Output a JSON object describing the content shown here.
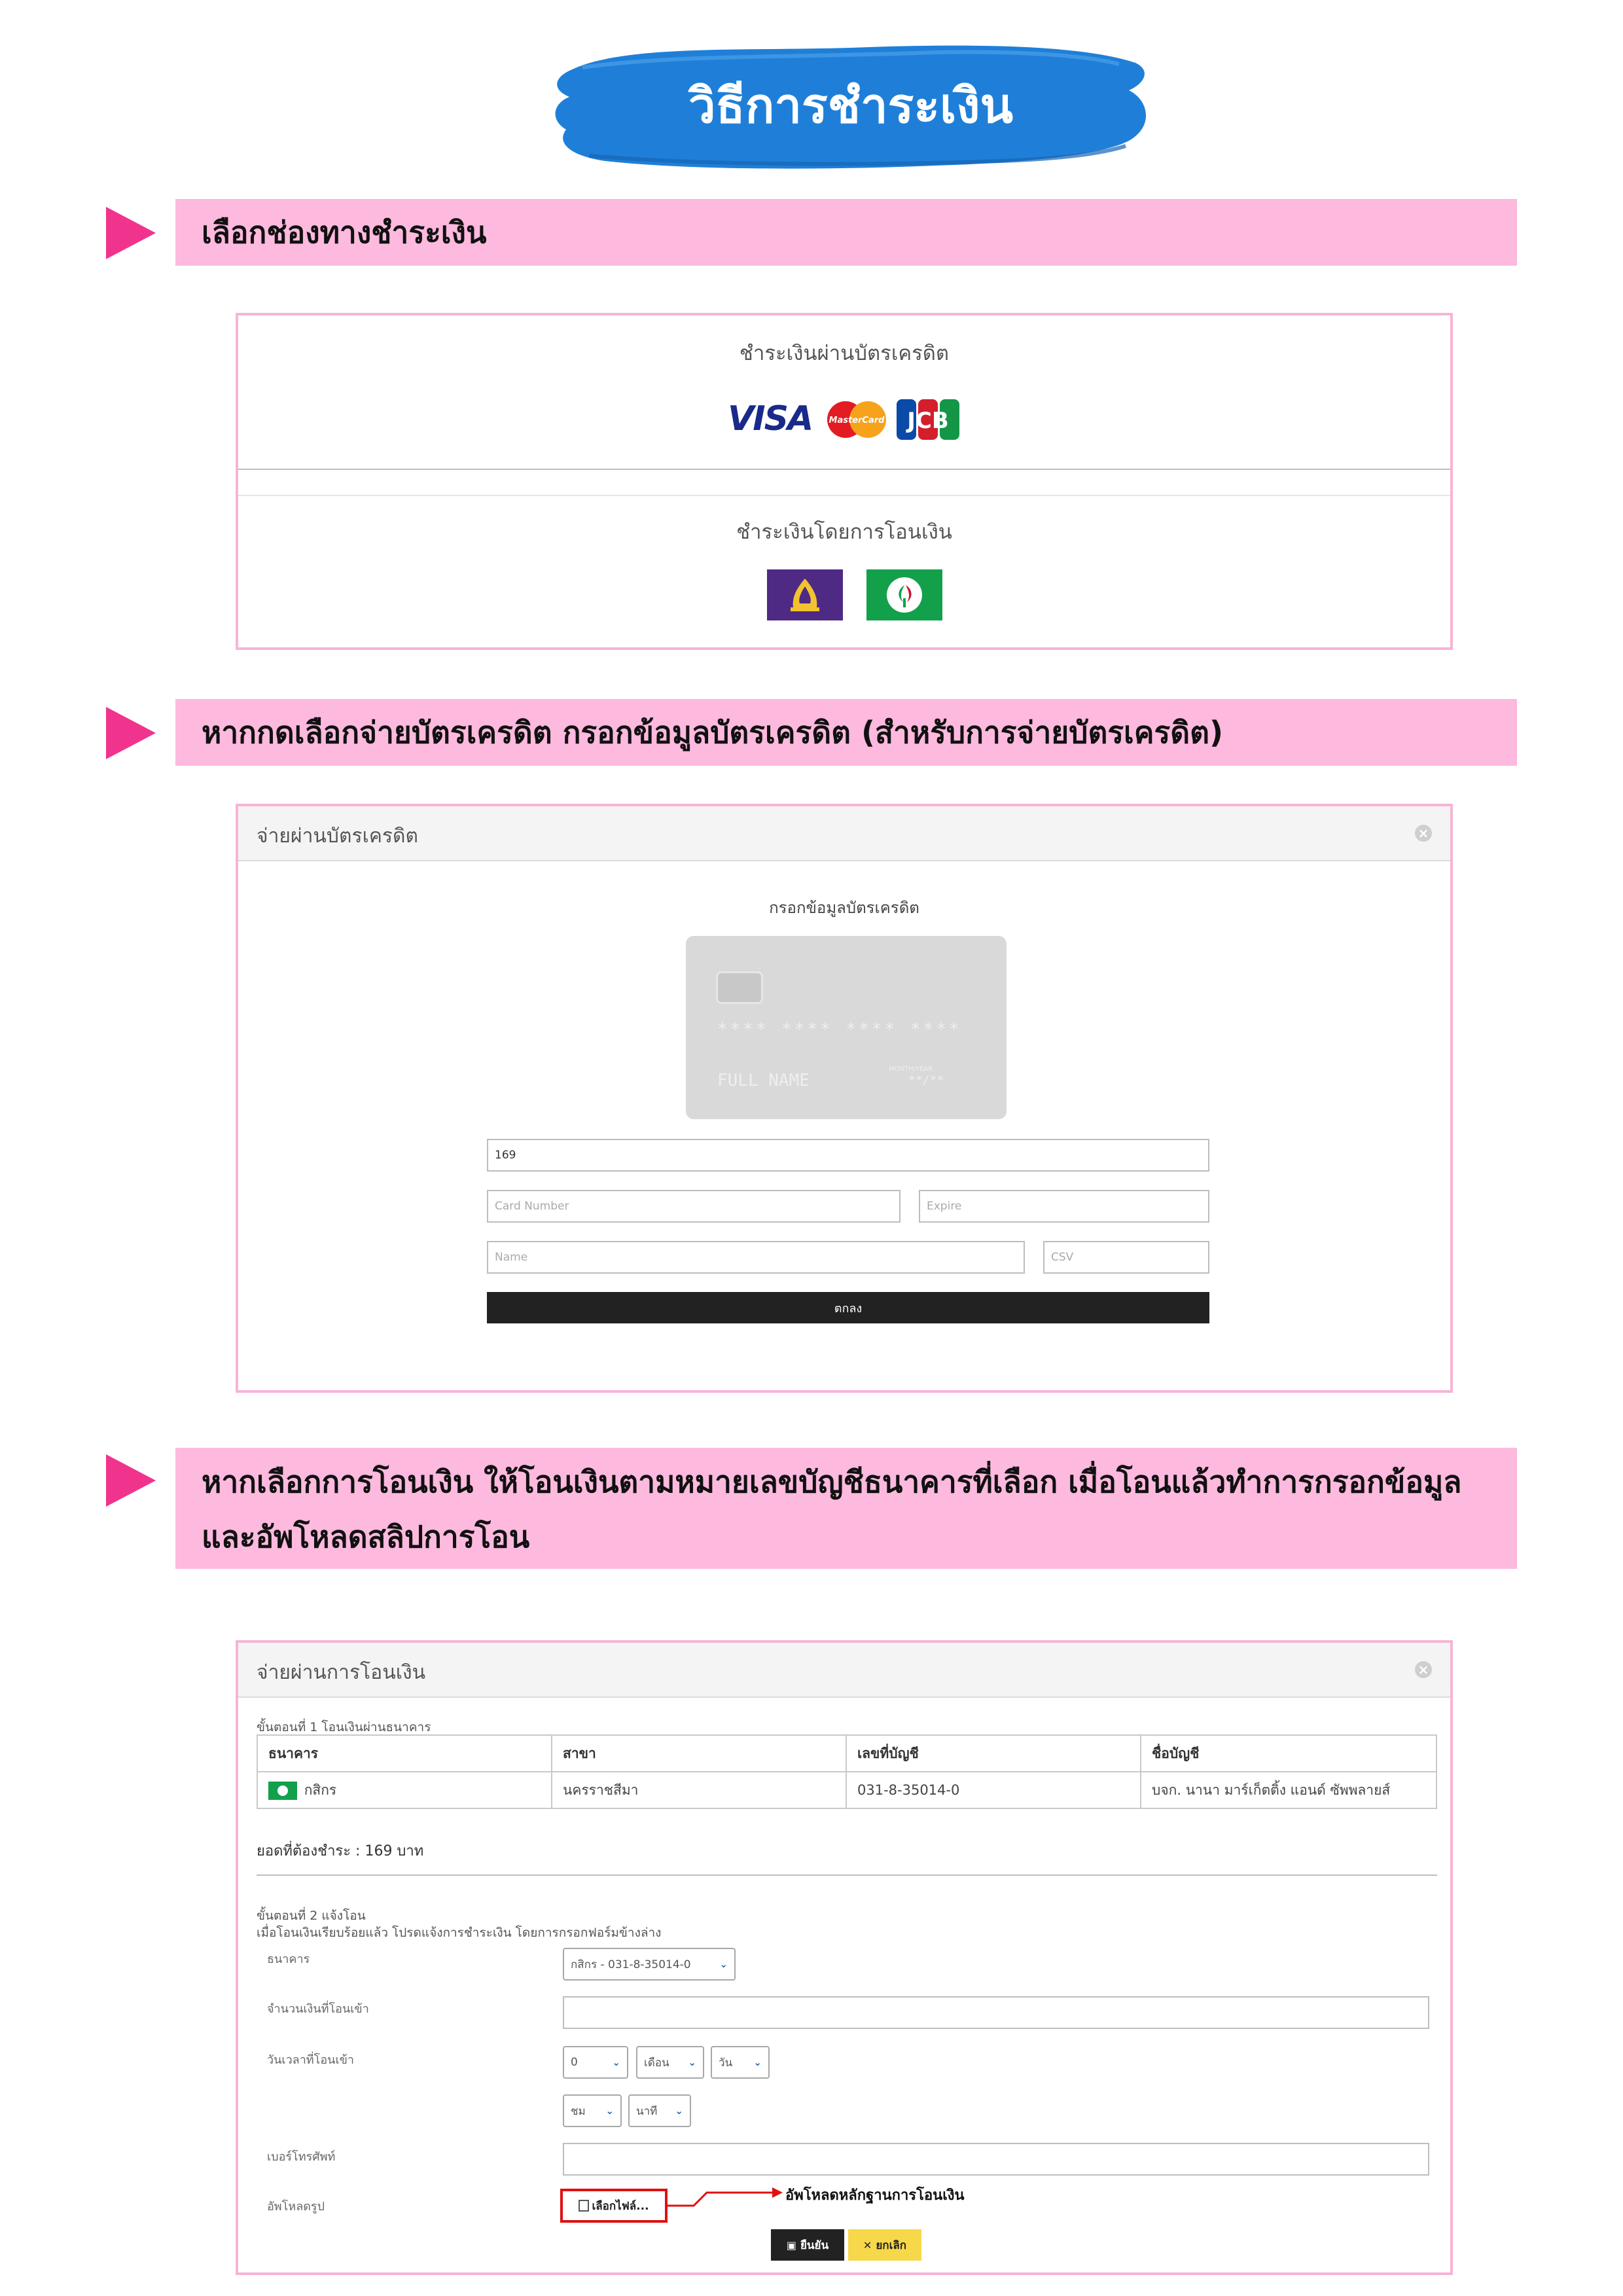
{
  "title": "วิธีการชำระเงิน",
  "sections": [
    {
      "heading": "เลือกช่องทางชำระเงิน"
    },
    {
      "heading": "หากกดเลือกจ่ายบัตรเครดิต  กรอกข้อมูลบัตรเครดิต (สำหรับการจ่ายบัตรเครดิต)"
    },
    {
      "heading_line1": "หากเลือกการโอนเงิน ให้โอนเงินตามหมายเลขบัญชีธนาคารที่เลือก  เมื่อโอนแล้วทำการกรอกข้อมูล",
      "heading_line2": "และอัพโหลดสลิปการโอน"
    }
  ],
  "payment_methods": {
    "credit_label": "ชำระเงินผ่านบัตรเครดิต",
    "card_brands": [
      "VISA",
      "MasterCard",
      "JCB"
    ],
    "transfer_label": "ชำระเงินโดยการโอนเงิน"
  },
  "credit_modal": {
    "title": "จ่ายผ่านบัตรเครดิต",
    "form_title": "กรอกข้อมูลบัตรเครดิต",
    "card_preview": {
      "number": "**** **** **** ****",
      "name": "FULL NAME",
      "expiry_label": "MONTH/YEAR",
      "expiry": "**/**"
    },
    "amount_value": "169",
    "card_number_placeholder": "Card Number",
    "expire_placeholder": "Expire",
    "name_placeholder": "Name",
    "csv_placeholder": "CSV",
    "submit_label": "ตกลง"
  },
  "transfer_modal": {
    "title": "จ่ายผ่านการโอนเงิน",
    "step1": "ขั้นตอนที่ 1 โอนเงินผ่านธนาคาร",
    "table_headers": [
      "ธนาคาร",
      "สาขา",
      "เลขที่บัญชี",
      "ชื่อบัญชี"
    ],
    "table_row": {
      "bank": "กสิกร",
      "branch": "นครราชสีมา",
      "account_no": "031-8-35014-0",
      "account_name": "บจก. นานา มาร์เก็ตติ้ง แอนด์ ซัพพลายส์"
    },
    "amount_due": "ยอดที่ต้องชำระ : 169 บาท",
    "step2": "ขั้นตอนที่ 2 แจ้งโอน",
    "step2_desc": "เมื่อโอนเงินเรียบร้อยแล้ว โปรดแจ้งการชำระเงิน โดยการกรอกฟอร์มข้างล่าง",
    "label_bank": "ธนาคาร",
    "bank_select": "กสิกร - 031-8-35014-0",
    "label_amount": "จำนวนเงินที่โอนเข้า",
    "label_datetime": "วันเวลาที่โอนเข้า",
    "year_select": "0",
    "month_select": "เดือน",
    "day_select": "วัน",
    "hour_select": "ชม",
    "minute_select": "นาที",
    "label_phone": "เบอร์โทรศัพท์",
    "label_upload": "อัพโหลดรูป",
    "choose_file": "เลือกไฟล์...",
    "upload_annotation": "อัพโหลดหลักฐานการโอนเงิน",
    "confirm_label": "ยืนยัน",
    "cancel_label": "ยกเลิก"
  },
  "colors": {
    "banner_blue": "#1f7fd8",
    "section_pink": "#fdb9de",
    "arrow_pink": "#f0348d",
    "frame_pink": "#f7b4d7",
    "scb_purple": "#4e2a84",
    "kbank_green": "#13a04b",
    "confirm_black": "#222222",
    "cancel_yellow": "#f7d84a",
    "highlight_red": "#e01010"
  }
}
